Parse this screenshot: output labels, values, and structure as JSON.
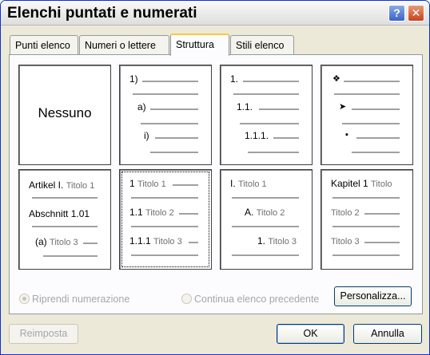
{
  "window": {
    "title": "Elenchi puntati e numerati"
  },
  "tabs": [
    {
      "label": "Punti elenco"
    },
    {
      "label": "Numeri o lettere"
    },
    {
      "label": "Struttura",
      "active": true
    },
    {
      "label": "Stili elenco"
    }
  ],
  "gallery": {
    "none_label": "Nessuno",
    "numbered": {
      "l1": "1)",
      "l2": "a)",
      "l3": "i)"
    },
    "decimal": {
      "l1": "1.",
      "l2": "1.1.",
      "l3": "1.1.1."
    },
    "symbols": {
      "l1": "❖",
      "l2": "➤",
      "l3": "▪"
    },
    "artikel": {
      "l1": "Artikel I.",
      "l1_style": "Titolo 1",
      "l2": "Abschnitt 1.01",
      "l3": "(a)",
      "l3_style": "Titolo 3"
    },
    "heading_num": {
      "l1": "1",
      "l1_style": "Titolo 1",
      "l2": "1.1",
      "l2_style": "Titolo 2",
      "l3": "1.1.1",
      "l3_style": "Titolo 3"
    },
    "roman": {
      "l1": "I.",
      "l1_style": "Titolo 1",
      "l2": "A.",
      "l2_style": "Titolo 2",
      "l3": "1.",
      "l3_style": "Titolo 3"
    },
    "kapitel": {
      "l1": "Kapitel 1",
      "l1_style": "Titolo",
      "l2_style": "Titolo 2",
      "l3_style": "Titolo 3"
    }
  },
  "options": {
    "restart_label": "Riprendi numerazione",
    "continue_label": "Continua elenco precedente"
  },
  "buttons": {
    "customize": "Personalizza...",
    "reset": "Reimposta",
    "ok": "OK",
    "cancel": "Annulla"
  }
}
